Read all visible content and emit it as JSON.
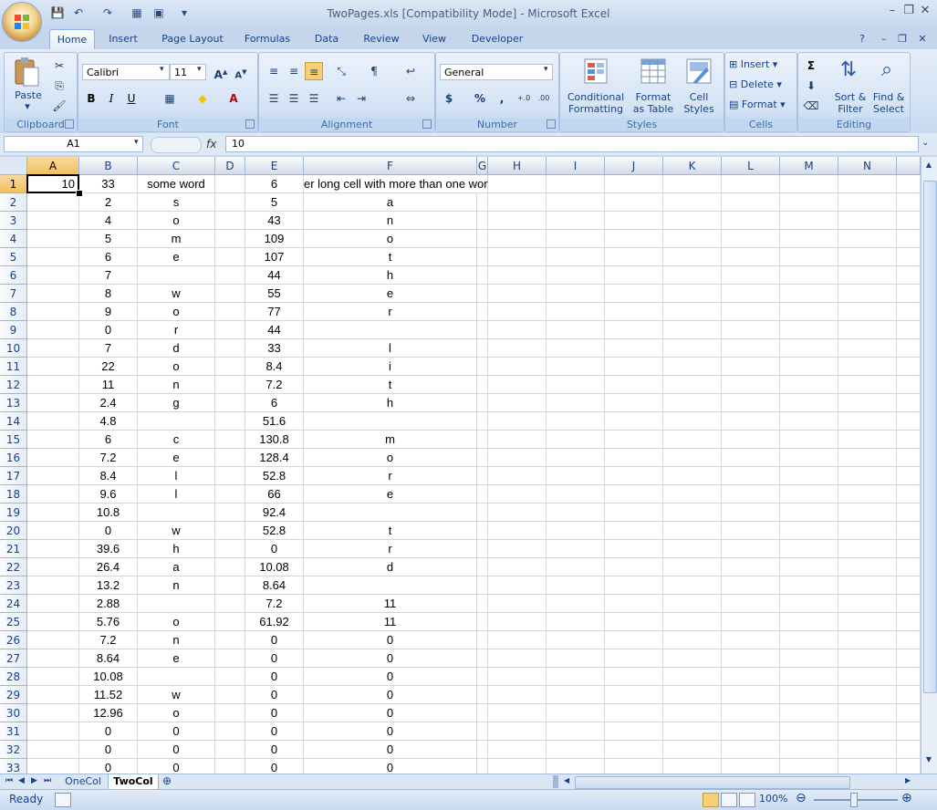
{
  "window": {
    "title": "TwoPages.xls  [Compatibility Mode] - Microsoft Excel"
  },
  "ribbon_tabs": [
    "Home",
    "Insert",
    "Page Layout",
    "Formulas",
    "Data",
    "Review",
    "View",
    "Developer"
  ],
  "active_tab": "Home",
  "clipboard": {
    "paste": "Paste",
    "label": "Clipboard"
  },
  "font": {
    "name": "Calibri",
    "size": "11",
    "label": "Font",
    "bold": "B",
    "italic": "I",
    "underline": "U"
  },
  "alignment": {
    "label": "Alignment"
  },
  "number": {
    "format": "General",
    "label": "Number",
    "currency": "$",
    "percent": "%",
    "comma": ",",
    "inc_decimal": "+.0",
    "dec_decimal": ".00"
  },
  "styles": {
    "label": "Styles",
    "conditional_1": "Conditional",
    "conditional_2": "Formatting",
    "format_table_1": "Format",
    "format_table_2": "as Table",
    "cell_styles_1": "Cell",
    "cell_styles_2": "Styles"
  },
  "cells": {
    "label": "Cells",
    "insert": "Insert",
    "delete": "Delete",
    "format": "Format"
  },
  "editing": {
    "label": "Editing",
    "sort_1": "Sort &",
    "sort_2": "Filter",
    "find_1": "Find &",
    "find_2": "Select"
  },
  "formula_bar": {
    "name_box": "A1",
    "fx": "fx",
    "value": "10"
  },
  "columns": [
    "A",
    "B",
    "C",
    "D",
    "E",
    "F",
    "G",
    "H",
    "I",
    "J",
    "K",
    "L",
    "M",
    "N"
  ],
  "rows": [
    {
      "n": "1",
      "A": "10",
      "B": "33",
      "C": "some word",
      "D": "",
      "E": "6",
      "F": "er long cell with more than one word"
    },
    {
      "n": "2",
      "A": "",
      "B": "2",
      "C": "s",
      "D": "",
      "E": "5",
      "F": "a"
    },
    {
      "n": "3",
      "A": "",
      "B": "4",
      "C": "o",
      "D": "",
      "E": "43",
      "F": "n"
    },
    {
      "n": "4",
      "A": "",
      "B": "5",
      "C": "m",
      "D": "",
      "E": "109",
      "F": "o"
    },
    {
      "n": "5",
      "A": "",
      "B": "6",
      "C": "e",
      "D": "",
      "E": "107",
      "F": "t"
    },
    {
      "n": "6",
      "A": "",
      "B": "7",
      "C": "",
      "D": "",
      "E": "44",
      "F": "h"
    },
    {
      "n": "7",
      "A": "",
      "B": "8",
      "C": "w",
      "D": "",
      "E": "55",
      "F": "e"
    },
    {
      "n": "8",
      "A": "",
      "B": "9",
      "C": "o",
      "D": "",
      "E": "77",
      "F": "r"
    },
    {
      "n": "9",
      "A": "",
      "B": "0",
      "C": "r",
      "D": "",
      "E": "44",
      "F": ""
    },
    {
      "n": "10",
      "A": "",
      "B": "7",
      "C": "d",
      "D": "",
      "E": "33",
      "F": "l"
    },
    {
      "n": "11",
      "A": "",
      "B": "22",
      "C": "o",
      "D": "",
      "E": "8.4",
      "F": "i"
    },
    {
      "n": "12",
      "A": "",
      "B": "11",
      "C": "n",
      "D": "",
      "E": "7.2",
      "F": "t"
    },
    {
      "n": "13",
      "A": "",
      "B": "2.4",
      "C": "g",
      "D": "",
      "E": "6",
      "F": "h"
    },
    {
      "n": "14",
      "A": "",
      "B": "4.8",
      "C": "",
      "D": "",
      "E": "51.6",
      "F": ""
    },
    {
      "n": "15",
      "A": "",
      "B": "6",
      "C": "c",
      "D": "",
      "E": "130.8",
      "F": "m"
    },
    {
      "n": "16",
      "A": "",
      "B": "7.2",
      "C": "e",
      "D": "",
      "E": "128.4",
      "F": "o"
    },
    {
      "n": "17",
      "A": "",
      "B": "8.4",
      "C": "l",
      "D": "",
      "E": "52.8",
      "F": "r"
    },
    {
      "n": "18",
      "A": "",
      "B": "9.6",
      "C": "l",
      "D": "",
      "E": "66",
      "F": "e"
    },
    {
      "n": "19",
      "A": "",
      "B": "10.8",
      "C": "",
      "D": "",
      "E": "92.4",
      "F": ""
    },
    {
      "n": "20",
      "A": "",
      "B": "0",
      "C": "w",
      "D": "",
      "E": "52.8",
      "F": "t"
    },
    {
      "n": "21",
      "A": "",
      "B": "39.6",
      "C": "h",
      "D": "",
      "E": "0",
      "F": "r"
    },
    {
      "n": "22",
      "A": "",
      "B": "26.4",
      "C": "a",
      "D": "",
      "E": "10.08",
      "F": "d"
    },
    {
      "n": "23",
      "A": "",
      "B": "13.2",
      "C": "n",
      "D": "",
      "E": "8.64",
      "F": ""
    },
    {
      "n": "24",
      "A": "",
      "B": "2.88",
      "C": "",
      "D": "",
      "E": "7.2",
      "F": "11"
    },
    {
      "n": "25",
      "A": "",
      "B": "5.76",
      "C": "o",
      "D": "",
      "E": "61.92",
      "F": "11"
    },
    {
      "n": "26",
      "A": "",
      "B": "7.2",
      "C": "n",
      "D": "",
      "E": "0",
      "F": "0"
    },
    {
      "n": "27",
      "A": "",
      "B": "8.64",
      "C": "e",
      "D": "",
      "E": "0",
      "F": "0"
    },
    {
      "n": "28",
      "A": "",
      "B": "10.08",
      "C": "",
      "D": "",
      "E": "0",
      "F": "0"
    },
    {
      "n": "29",
      "A": "",
      "B": "11.52",
      "C": "w",
      "D": "",
      "E": "0",
      "F": "0"
    },
    {
      "n": "30",
      "A": "",
      "B": "12.96",
      "C": "o",
      "D": "",
      "E": "0",
      "F": "0"
    },
    {
      "n": "31",
      "A": "",
      "B": "0",
      "C": "0",
      "D": "",
      "E": "0",
      "F": "0"
    },
    {
      "n": "32",
      "A": "",
      "B": "0",
      "C": "0",
      "D": "",
      "E": "0",
      "F": "0"
    },
    {
      "n": "33",
      "A": "",
      "B": "0",
      "C": "0",
      "D": "",
      "E": "0",
      "F": "0"
    }
  ],
  "sheet_tabs": [
    "OneCol",
    "TwoCol"
  ],
  "active_sheet": "TwoCol",
  "status": {
    "ready": "Ready",
    "zoom": "100%"
  },
  "colors": {
    "selection_header": "#f1c15f",
    "ribbon_bg": "#d5e3f5",
    "accent": "#15428b"
  }
}
